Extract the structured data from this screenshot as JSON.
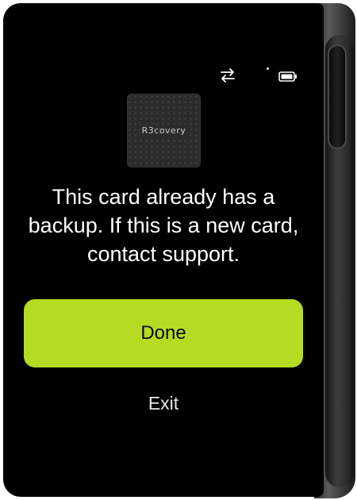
{
  "status_bar": {
    "transfer_icon": "transfer-arrows-icon",
    "battery_icon": "battery-icon"
  },
  "card": {
    "logo_text": "R3covery"
  },
  "message": {
    "text": "This card already has a backup. If this is a new card, contact support."
  },
  "actions": {
    "primary_label": "Done",
    "secondary_label": "Exit"
  },
  "colors": {
    "screen_background": "#000000",
    "accent": "#b5dc22",
    "text": "#ffffff"
  }
}
